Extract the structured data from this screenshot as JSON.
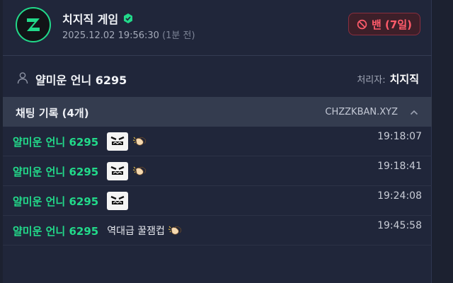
{
  "header": {
    "title": "치지직 게임",
    "datetime": "2025.12.02 19:56:30",
    "relative": "(1분 전)",
    "ban_label": "밴 (7일)"
  },
  "user": {
    "name": "얄미운 언니 6295",
    "handler_label": "처리자:",
    "handler_name": "치지직"
  },
  "chat": {
    "title": "채팅 기록 (4개)",
    "site": "CHZZKBAN.XYZ",
    "messages": [
      {
        "user": "얄미운 언니 6295",
        "text": "",
        "emotes": [
          "face-emote",
          "clap-emote"
        ],
        "time": "19:18:07"
      },
      {
        "user": "얄미운 언니 6295",
        "text": "",
        "emotes": [
          "face-emote",
          "clap-emote"
        ],
        "time": "19:18:41"
      },
      {
        "user": "얄미운 언니 6295",
        "text": "",
        "emotes": [
          "face-emote"
        ],
        "time": "19:24:08"
      },
      {
        "user": "얄미운 언니 6295",
        "text": "역대급 꿀잼컵",
        "emotes": [
          "clap-emote"
        ],
        "time": "19:45:58"
      }
    ]
  },
  "colors": {
    "accent": "#22d98a",
    "ban": "#ff5b6a",
    "background": "#20263a"
  }
}
